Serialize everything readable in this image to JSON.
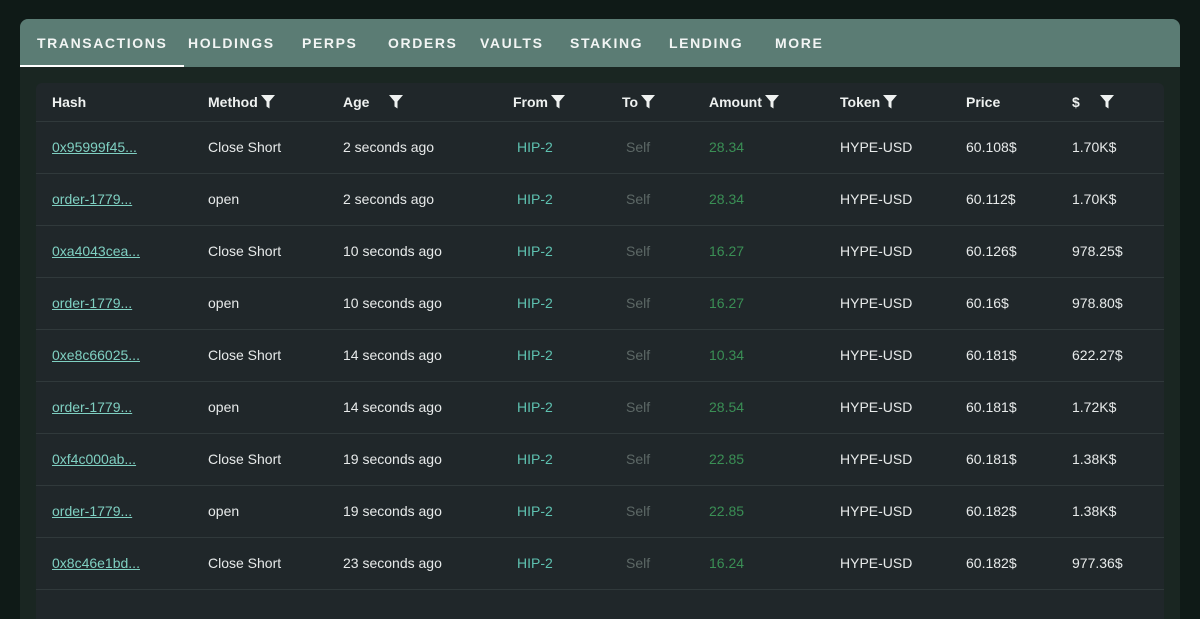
{
  "tabs": [
    {
      "label": "TRANSACTIONS",
      "active": true
    },
    {
      "label": "HOLDINGS"
    },
    {
      "label": "PERPS"
    },
    {
      "label": "ORDERS"
    },
    {
      "label": "VAULTS"
    },
    {
      "label": "STAKING"
    },
    {
      "label": "LENDING"
    },
    {
      "label": "MORE"
    }
  ],
  "table": {
    "columns": [
      "Hash",
      "Method",
      "Age",
      "From",
      "To",
      "Amount",
      "Token",
      "Price",
      "$"
    ],
    "filter_icon": "filter-icon",
    "rows": [
      {
        "hash": "0x95999f45...",
        "method": "Close Short",
        "age": "2 seconds ago",
        "from": "HIP-2",
        "to": "Self",
        "amount": "28.34",
        "token": "HYPE-USD",
        "price": "60.108$",
        "usd": "1.70K$"
      },
      {
        "hash": "order-1779...",
        "method": "open",
        "age": "2 seconds ago",
        "from": "HIP-2",
        "to": "Self",
        "amount": "28.34",
        "token": "HYPE-USD",
        "price": "60.112$",
        "usd": "1.70K$"
      },
      {
        "hash": "0xa4043cea...",
        "method": "Close Short",
        "age": "10 seconds ago",
        "from": "HIP-2",
        "to": "Self",
        "amount": "16.27",
        "token": "HYPE-USD",
        "price": "60.126$",
        "usd": "978.25$"
      },
      {
        "hash": "order-1779...",
        "method": "open",
        "age": "10 seconds ago",
        "from": "HIP-2",
        "to": "Self",
        "amount": "16.27",
        "token": "HYPE-USD",
        "price": "60.16$",
        "usd": "978.80$"
      },
      {
        "hash": "0xe8c66025...",
        "method": "Close Short",
        "age": "14 seconds ago",
        "from": "HIP-2",
        "to": "Self",
        "amount": "10.34",
        "token": "HYPE-USD",
        "price": "60.181$",
        "usd": "622.27$"
      },
      {
        "hash": "order-1779...",
        "method": "open",
        "age": "14 seconds ago",
        "from": "HIP-2",
        "to": "Self",
        "amount": "28.54",
        "token": "HYPE-USD",
        "price": "60.181$",
        "usd": "1.72K$"
      },
      {
        "hash": "0xf4c000ab...",
        "method": "Close Short",
        "age": "19 seconds ago",
        "from": "HIP-2",
        "to": "Self",
        "amount": "22.85",
        "token": "HYPE-USD",
        "price": "60.181$",
        "usd": "1.38K$"
      },
      {
        "hash": "order-1779...",
        "method": "open",
        "age": "19 seconds ago",
        "from": "HIP-2",
        "to": "Self",
        "amount": "22.85",
        "token": "HYPE-USD",
        "price": "60.182$",
        "usd": "1.38K$"
      },
      {
        "hash": "0x8c46e1bd...",
        "method": "Close Short",
        "age": "23 seconds ago",
        "from": "HIP-2",
        "to": "Self",
        "amount": "16.24",
        "token": "HYPE-USD",
        "price": "60.182$",
        "usd": "977.36$"
      }
    ]
  },
  "colors": {
    "tabbar": "#5b7c74",
    "panel": "#1a2622",
    "table": "#20272a",
    "hash_link": "#7fd0c2",
    "from": "#5ec1b0",
    "to": "#5d6866",
    "amount": "#3a8f55"
  }
}
